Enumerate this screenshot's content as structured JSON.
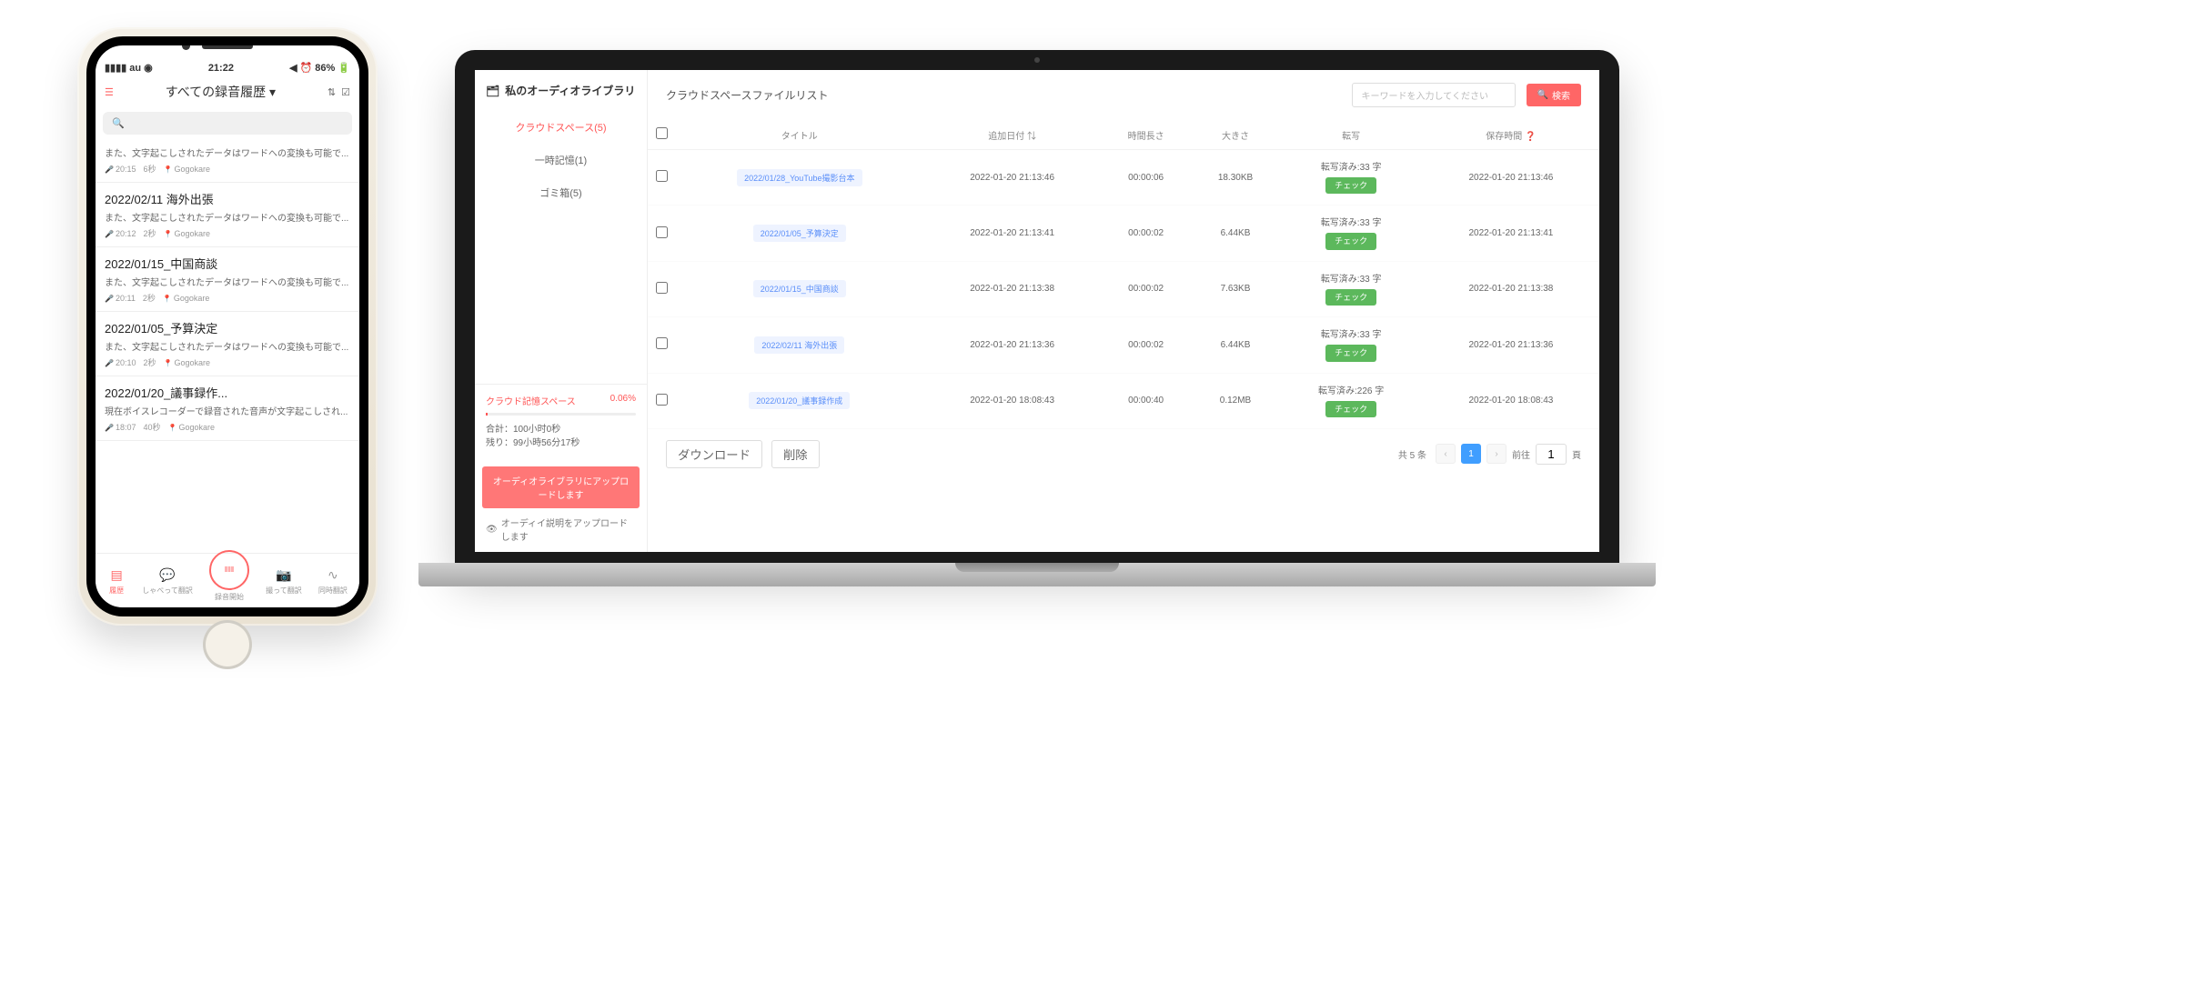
{
  "phone": {
    "status": {
      "carrier": "au",
      "time": "21:22",
      "battery": "86%"
    },
    "header": {
      "title": "すべての録音履歴 ▾"
    },
    "search_placeholder": "",
    "items": [
      {
        "title": "",
        "desc": "また、文字起こしされたデータはワードへの変換も可能で...",
        "time": "20:15",
        "dur": "6秒",
        "loc": "Gogokare"
      },
      {
        "title": "2022/02/11 海外出張",
        "desc": "また、文字起こしされたデータはワードへの変換も可能で...",
        "time": "20:12",
        "dur": "2秒",
        "loc": "Gogokare"
      },
      {
        "title": "2022/01/15_中国商談",
        "desc": "また、文字起こしされたデータはワードへの変換も可能で...",
        "time": "20:11",
        "dur": "2秒",
        "loc": "Gogokare"
      },
      {
        "title": "2022/01/05_予算決定",
        "desc": "また、文字起こしされたデータはワードへの変換も可能で...",
        "time": "20:10",
        "dur": "2秒",
        "loc": "Gogokare"
      },
      {
        "title": "2022/01/20_議事録作...",
        "desc": "現在ボイスレコーダーで録音された音声が文字起こしされ...",
        "time": "18:07",
        "dur": "40秒",
        "loc": "Gogokare"
      }
    ],
    "nav": {
      "history": "履歴",
      "speak_translate": "しゃべって翻訳",
      "record": "録音開始",
      "photo_translate": "撮って翻訳",
      "simul": "同時翻訳"
    }
  },
  "laptop": {
    "sidebar": {
      "title": "私のオーディオライブラリ",
      "nav": {
        "cloud": "クラウドスペース(5)",
        "temp": "一時記憶(1)",
        "trash": "ゴミ箱(5)"
      },
      "storage": {
        "title": "クラウド記憶スペース",
        "pct": "0.06%",
        "total_label": "合計：",
        "total": "100小时0秒",
        "remain_label": "残り：",
        "remain": "99小時56分17秒"
      },
      "upload_btn": "オーディオライブラリにアップロードします",
      "upload_desc": "オーディイ説明をアップロードします"
    },
    "main": {
      "title": "クラウドスペースファイルリスト",
      "search_placeholder": "キーワードを入力してください",
      "search_btn": "検索",
      "cols": {
        "title": "タイトル",
        "date": "追加日付",
        "duration": "時間長さ",
        "size": "大きさ",
        "transcribe": "転写",
        "saved": "保存時間"
      },
      "rows": [
        {
          "title": "2022/01/28_YouTube撮影台本",
          "date": "2022-01-20 21:13:46",
          "dur": "00:00:06",
          "size": "18.30KB",
          "trans": "転写済み:33 字",
          "saved": "2022-01-20 21:13:46"
        },
        {
          "title": "2022/01/05_予算決定",
          "date": "2022-01-20 21:13:41",
          "dur": "00:00:02",
          "size": "6.44KB",
          "trans": "転写済み:33 字",
          "saved": "2022-01-20 21:13:41"
        },
        {
          "title": "2022/01/15_中国商談",
          "date": "2022-01-20 21:13:38",
          "dur": "00:00:02",
          "size": "7.63KB",
          "trans": "転写済み:33 字",
          "saved": "2022-01-20 21:13:38"
        },
        {
          "title": "2022/02/11 海外出張",
          "date": "2022-01-20 21:13:36",
          "dur": "00:00:02",
          "size": "6.44KB",
          "trans": "転写済み:33 字",
          "saved": "2022-01-20 21:13:36"
        },
        {
          "title": "2022/01/20_議事録作成",
          "date": "2022-01-20 18:08:43",
          "dur": "00:00:40",
          "size": "0.12MB",
          "trans": "転写済み:226 字",
          "saved": "2022-01-20 18:08:43"
        }
      ],
      "check_btn": "チェック",
      "footer": {
        "download": "ダウンロード",
        "delete": "削除",
        "total": "共 5 条",
        "goto": "前往",
        "page": "1",
        "pages_suffix": "頁"
      }
    }
  }
}
